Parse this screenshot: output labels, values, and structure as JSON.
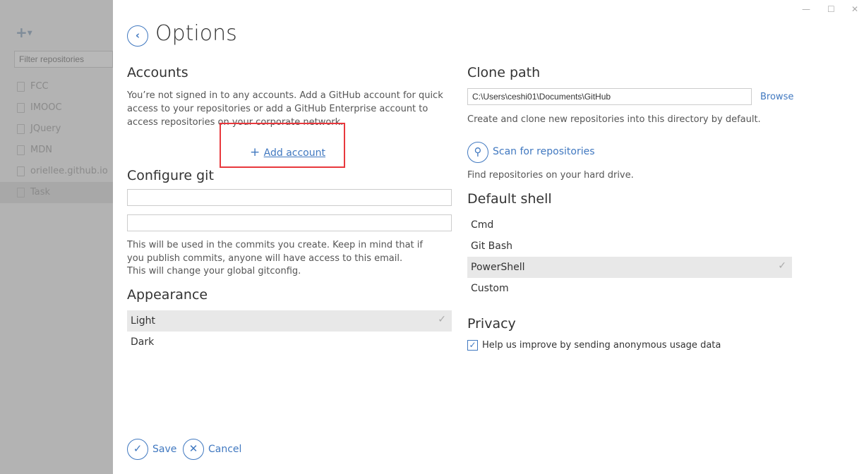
{
  "sidebar": {
    "add_label": "+",
    "filter_placeholder": "Filter repositories",
    "repos": [
      "FCC",
      "IMOOC",
      "JQuery",
      "MDN",
      "oriellee.github.io",
      "Task"
    ],
    "selected": "Task"
  },
  "header": {
    "title": "Options"
  },
  "accounts": {
    "heading": "Accounts",
    "description": "You’re not signed in to any accounts. Add a GitHub account for quick access to your repositories or add a GitHub Enterprise account to access repositories on your corporate network.",
    "add_label": "Add account"
  },
  "git": {
    "heading": "Configure git",
    "name_value": "",
    "email_value": "",
    "note1": "This will be used in the commits you create. Keep in mind that if you publish commits, anyone will have access to this email.",
    "note2": "This will change your global gitconfig."
  },
  "appearance": {
    "heading": "Appearance",
    "options": [
      "Light",
      "Dark"
    ],
    "selected": "Light"
  },
  "clone": {
    "heading": "Clone path",
    "path": "C:\\Users\\ceshi01\\Documents\\GitHub",
    "browse": "Browse",
    "description": "Create and clone new repositories into this directory by default.",
    "scan_label": "Scan for repositories",
    "scan_desc": "Find repositories on your hard drive."
  },
  "shell": {
    "heading": "Default shell",
    "options": [
      "Cmd",
      "Git Bash",
      "PowerShell",
      "Custom"
    ],
    "selected": "PowerShell"
  },
  "privacy": {
    "heading": "Privacy",
    "usage_label": "Help us improve by sending anonymous usage data",
    "usage_checked": true
  },
  "footer": {
    "save": "Save",
    "cancel": "Cancel"
  },
  "colors": {
    "accent": "#4078c0",
    "highlight": "#e8383d"
  }
}
